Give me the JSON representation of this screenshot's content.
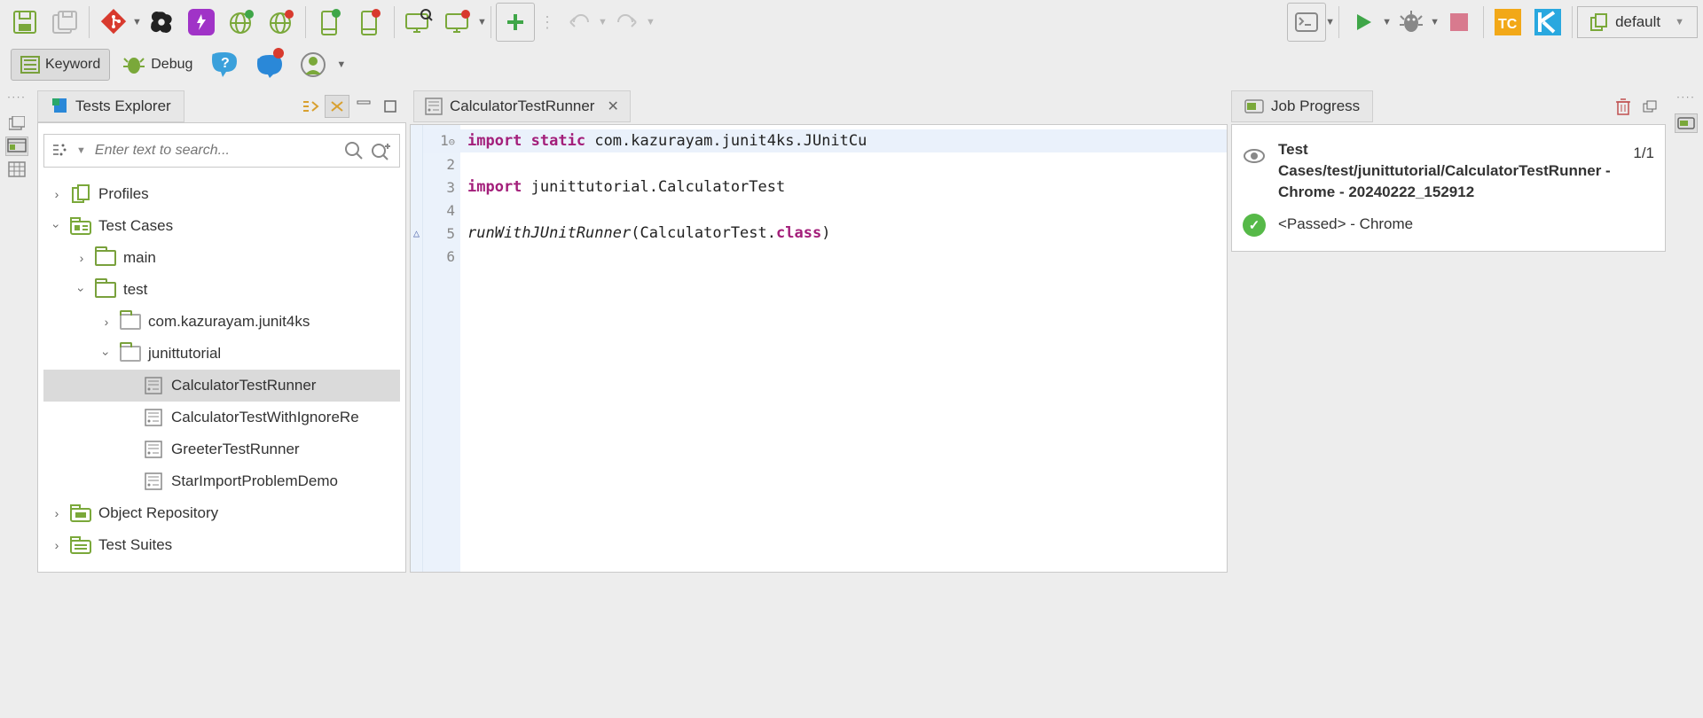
{
  "toolbar2": {
    "keyword_label": "Keyword",
    "debug_label": "Debug"
  },
  "browser_selector": {
    "label": "default"
  },
  "explorer": {
    "title": "Tests Explorer",
    "search_placeholder": "Enter text to search...",
    "nodes": {
      "profiles": "Profiles",
      "testcases": "Test Cases",
      "main": "main",
      "test": "test",
      "pkg1": "com.kazurayam.junit4ks",
      "pkg2": "junittutorial",
      "tc1": "CalculatorTestRunner",
      "tc2": "CalculatorTestWithIgnoreRe",
      "tc3": "GreeterTestRunner",
      "tc4": "StarImportProblemDemo",
      "objrepo": "Object Repository",
      "suites": "Test Suites"
    }
  },
  "editor": {
    "tab_title": "CalculatorTestRunner",
    "lines": [
      "1",
      "2",
      "3",
      "4",
      "5",
      "6"
    ],
    "l1": {
      "a": "import",
      "b": "static",
      "c": " com.kazurayam.junit4ks.JUnitCu"
    },
    "l3": {
      "a": "import",
      "b": " junittutorial.CalculatorTest"
    },
    "l5": {
      "a": "runWithJUnitRunner",
      "b": "(CalculatorTest.",
      "c": "class",
      "d": ")"
    }
  },
  "job": {
    "panel_title": "Job Progress",
    "title": "Test Cases/test/junittutorial/CalculatorTestRunner - Chrome - 20240222_152912",
    "count": "1/1",
    "result": "<Passed> - Chrome"
  }
}
